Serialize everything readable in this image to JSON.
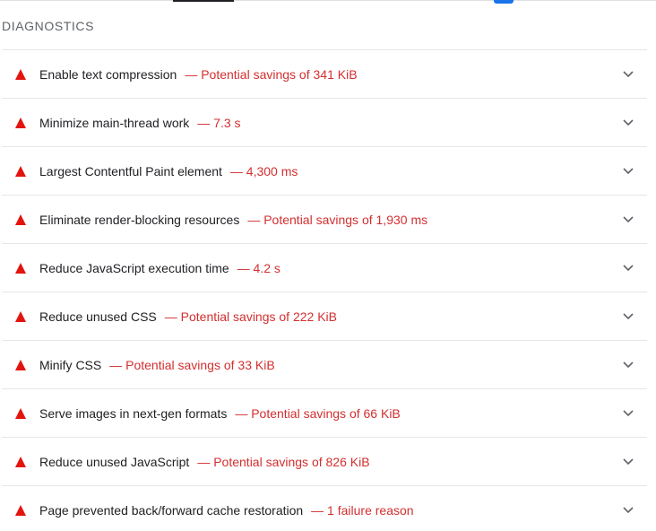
{
  "section": {
    "title": "DIAGNOSTICS"
  },
  "colors": {
    "fail": "#d32f2f",
    "text": "#202124",
    "muted": "#5f6368",
    "accent": "#1a73e8"
  },
  "audits": [
    {
      "title": "Enable text compression",
      "value": "— Potential savings of 341 KiB",
      "icon": "warning-triangle-icon"
    },
    {
      "title": "Minimize main-thread work",
      "value": "— 7.3 s",
      "icon": "warning-triangle-icon"
    },
    {
      "title": "Largest Contentful Paint element",
      "value": "— 4,300 ms",
      "icon": "warning-triangle-icon"
    },
    {
      "title": "Eliminate render-blocking resources",
      "value": "— Potential savings of 1,930 ms",
      "icon": "warning-triangle-icon"
    },
    {
      "title": "Reduce JavaScript execution time",
      "value": "— 4.2 s",
      "icon": "warning-triangle-icon"
    },
    {
      "title": "Reduce unused CSS",
      "value": "— Potential savings of 222 KiB",
      "icon": "warning-triangle-icon"
    },
    {
      "title": "Minify CSS",
      "value": "— Potential savings of 33 KiB",
      "icon": "warning-triangle-icon"
    },
    {
      "title": "Serve images in next-gen formats",
      "value": "— Potential savings of 66 KiB",
      "icon": "warning-triangle-icon"
    },
    {
      "title": "Reduce unused JavaScript",
      "value": "— Potential savings of 826 KiB",
      "icon": "warning-triangle-icon"
    },
    {
      "title": "Page prevented back/forward cache restoration",
      "value": "— 1 failure reason",
      "icon": "warning-triangle-icon"
    }
  ]
}
